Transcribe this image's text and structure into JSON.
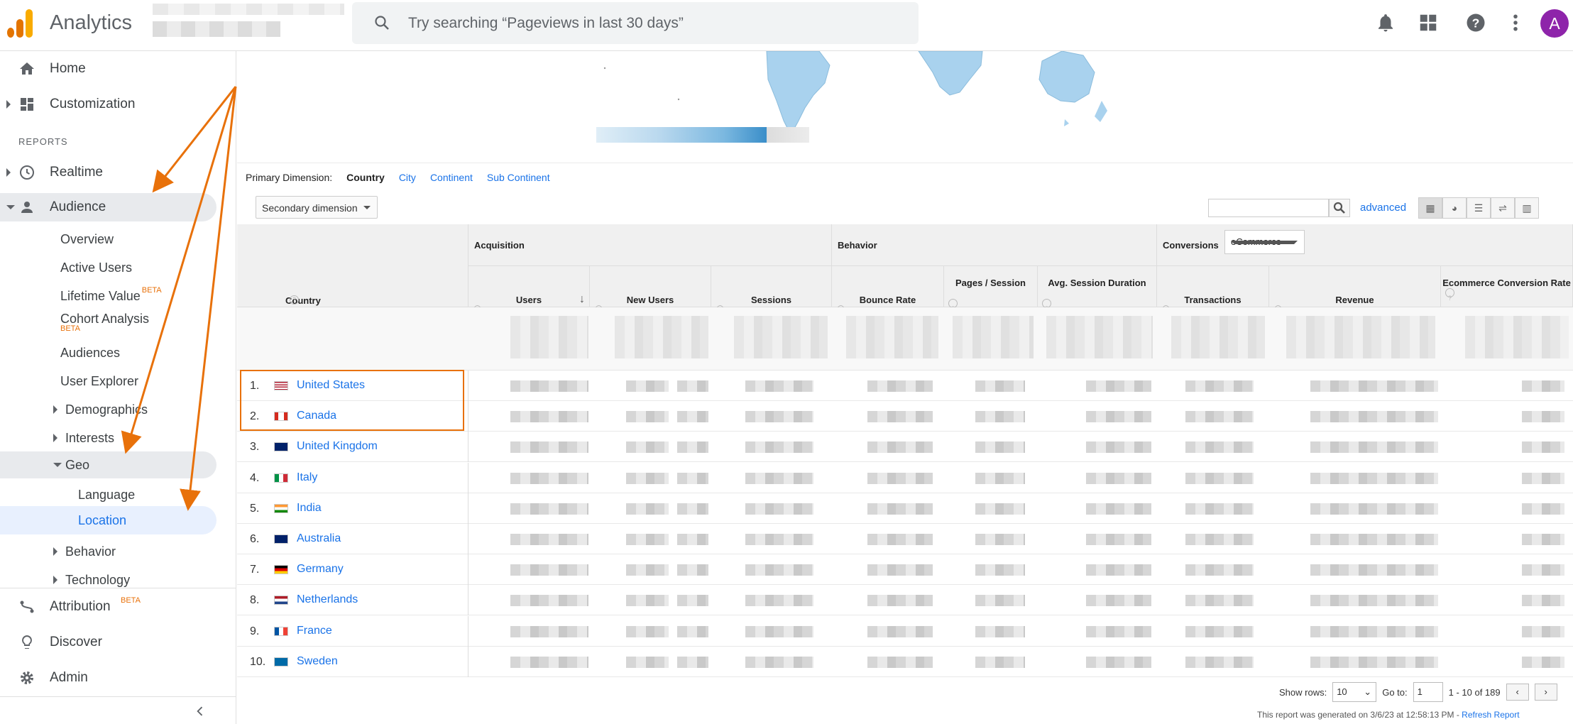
{
  "app": {
    "title": "Analytics"
  },
  "search": {
    "placeholder": "Try searching “Pageviews in last 30 days”"
  },
  "header_icons": [
    "bell-icon",
    "apps-grid-icon",
    "help-icon",
    "more-vert-icon"
  ],
  "user": {
    "avatar_letter": "A",
    "avatar_color": "#8e24aa"
  },
  "sidebar": {
    "home": "Home",
    "customization": "Customization",
    "reports_label": "REPORTS",
    "realtime": "Realtime",
    "audience": "Audience",
    "audience_items": {
      "overview": "Overview",
      "active_users": "Active Users",
      "lifetime_value": "Lifetime Value",
      "cohort_analysis": "Cohort Analysis",
      "audiences": "Audiences",
      "user_explorer": "User Explorer",
      "demographics": "Demographics",
      "interests": "Interests",
      "geo": "Geo",
      "language": "Language",
      "location": "Location",
      "behavior": "Behavior",
      "technology": "Technology"
    },
    "beta": "BETA",
    "attribution": "Attribution",
    "discover": "Discover",
    "admin": "Admin"
  },
  "primary_dimension": {
    "label": "Primary Dimension:",
    "active": "Country",
    "options": [
      "City",
      "Continent",
      "Sub Continent"
    ]
  },
  "secondary_dimension": "Secondary dimension",
  "advanced_link": "advanced",
  "table": {
    "country_header": "Country",
    "groups": {
      "acquisition": "Acquisition",
      "behavior": "Behavior",
      "conversions": "Conversions"
    },
    "conversions_select": "eCommerce",
    "columns": {
      "users": "Users",
      "new_users": "New Users",
      "sessions": "Sessions",
      "bounce_rate": "Bounce Rate",
      "pages_session": "Pages / Session",
      "avg_session": "Avg. Session Duration",
      "transactions": "Transactions",
      "revenue": "Revenue",
      "ecom_rate": "Ecommerce Conversion Rate"
    },
    "rows": [
      {
        "rank": "1.",
        "country": "United States"
      },
      {
        "rank": "2.",
        "country": "Canada"
      },
      {
        "rank": "3.",
        "country": "United Kingdom"
      },
      {
        "rank": "4.",
        "country": "Italy"
      },
      {
        "rank": "5.",
        "country": "India"
      },
      {
        "rank": "6.",
        "country": "Australia"
      },
      {
        "rank": "7.",
        "country": "Germany"
      },
      {
        "rank": "8.",
        "country": "Netherlands"
      },
      {
        "rank": "9.",
        "country": "France"
      },
      {
        "rank": "10.",
        "country": "Sweden"
      }
    ]
  },
  "footer": {
    "show_rows_label": "Show rows:",
    "show_rows_value": "10",
    "goto_label": "Go to:",
    "goto_value": "1",
    "range": "1 - 10 of 189",
    "generated": "This report was generated on 3/6/23 at 12:58:13 PM - ",
    "refresh": "Refresh Report"
  },
  "colors": {
    "accent": "#1a73e8",
    "highlight": "#e8710a"
  }
}
